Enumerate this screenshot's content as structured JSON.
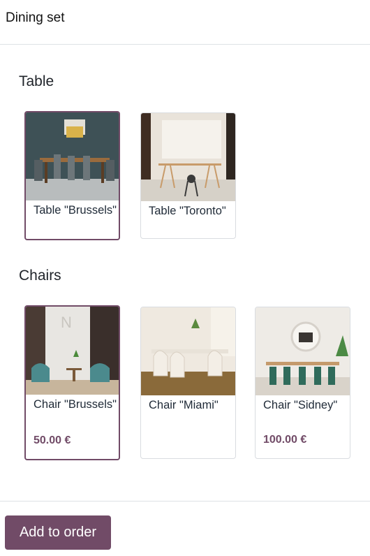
{
  "header": {
    "title": "Dining set"
  },
  "sections": [
    {
      "title": "Table",
      "products": [
        {
          "name": "Table \"Brussels\"",
          "selected": true
        },
        {
          "name": "Table \"Toronto\"",
          "selected": false
        }
      ]
    },
    {
      "title": "Chairs",
      "products": [
        {
          "name": "Chair \"Brussels\"",
          "price": "50.00 €",
          "selected": true
        },
        {
          "name": "Chair \"Miami\"",
          "price": "",
          "selected": false
        },
        {
          "name": "Chair \"Sidney\"",
          "price": "100.00 €",
          "selected": false
        }
      ]
    }
  ],
  "footer": {
    "add_button": "Add to order"
  },
  "colors": {
    "accent": "#714b67"
  }
}
